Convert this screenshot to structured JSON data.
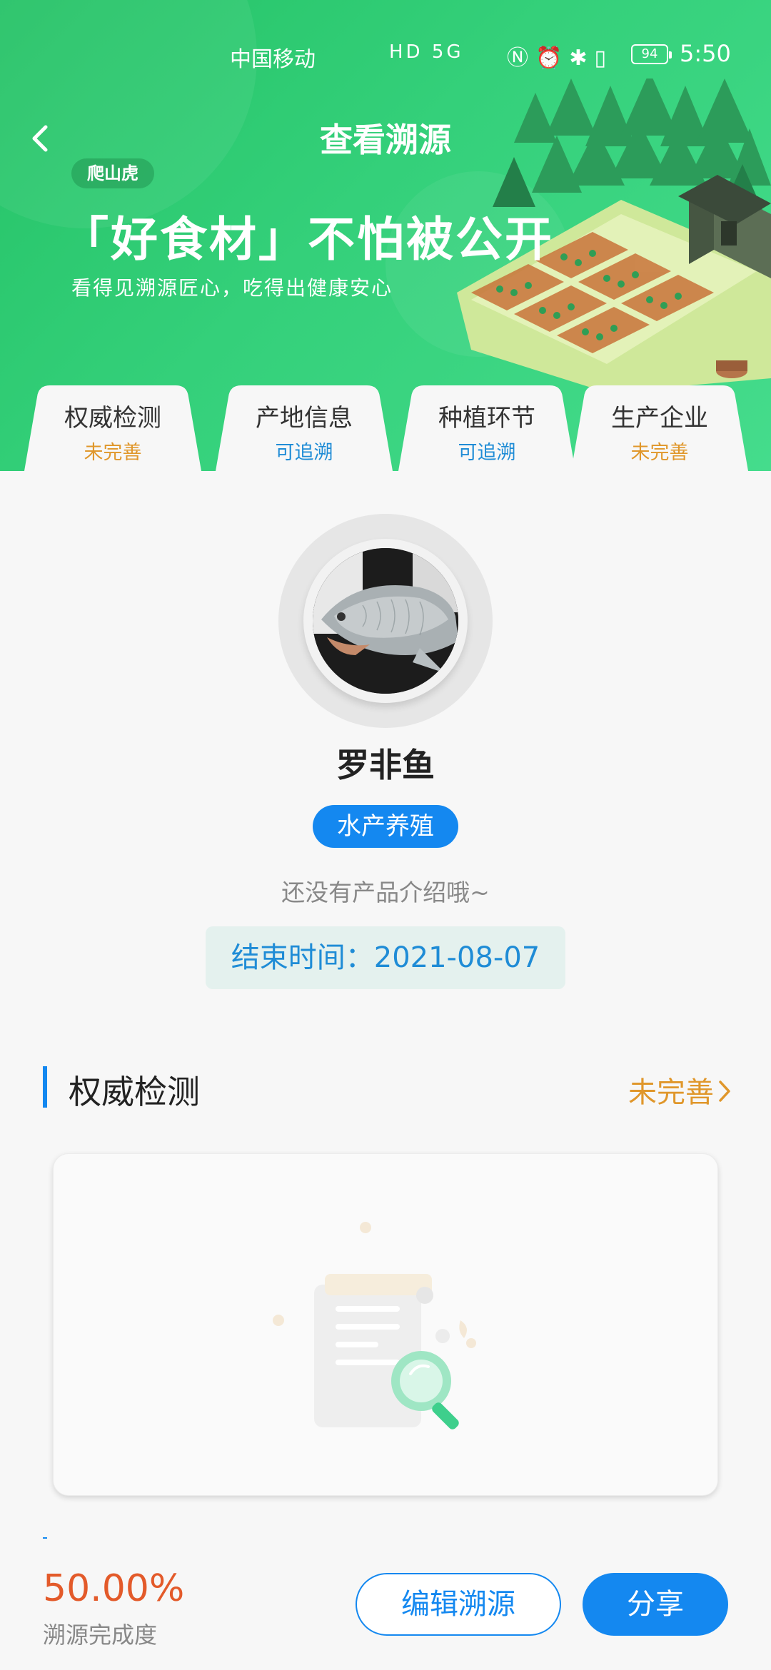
{
  "status_bar": {
    "carrier": "中国移动",
    "network_badges": "HD 5G",
    "battery": "94",
    "time": "5:50"
  },
  "header": {
    "title": "查看溯源",
    "brand_tag": "爬山虎",
    "slogan": "「好食材」不怕被公开",
    "sub_slogan": "看得见溯源匠心，吃得出健康安心"
  },
  "tabs": [
    {
      "label": "权威检测",
      "status": "未完善",
      "status_color": "#e0972b"
    },
    {
      "label": "产地信息",
      "status": "可追溯",
      "status_color": "#1f8cd6"
    },
    {
      "label": "种植环节",
      "status": "可追溯",
      "status_color": "#1f8cd6"
    },
    {
      "label": "生产企业",
      "status": "未完善",
      "status_color": "#e0972b"
    }
  ],
  "product": {
    "name": "罗非鱼",
    "category": "水产养殖",
    "intro": "还没有产品介绍哦~",
    "end_time": "结束时间：2021-08-07"
  },
  "section": {
    "title": "权威检测",
    "status": "未完善"
  },
  "footer": {
    "progress_value": "50.00%",
    "progress_label": "溯源完成度",
    "edit_label": "编辑溯源",
    "share_label": "分享"
  },
  "colors": {
    "primary_blue": "#1488f0",
    "header_green": "#34d07a",
    "warning_orange": "#e0972b",
    "progress_red": "#e35a2a"
  }
}
